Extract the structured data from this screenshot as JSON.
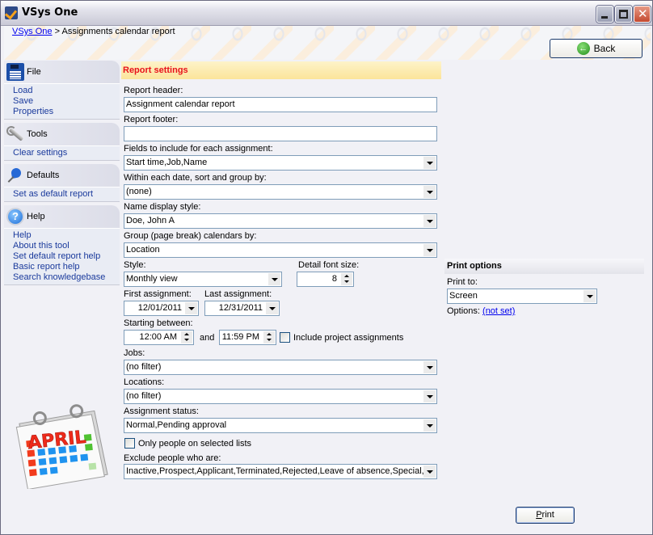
{
  "window": {
    "title": "VSys One",
    "controls": {
      "minimize": "minimize",
      "maximize": "maximize",
      "close": "close"
    }
  },
  "breadcrumb": {
    "root": "VSys One",
    "separator": ">",
    "current": "Assignments calendar report"
  },
  "back_button": {
    "label": "Back",
    "icon": "back-arrow-icon"
  },
  "sidebar": {
    "groups": [
      {
        "title": "File",
        "icon": "floppy-disk-icon",
        "items": [
          "Load",
          "Save",
          "Properties"
        ]
      },
      {
        "title": "Tools",
        "icon": "wrench-icon",
        "items": [
          "Clear settings"
        ]
      },
      {
        "title": "Defaults",
        "icon": "pushpin-icon",
        "items": [
          "Set as default report"
        ]
      },
      {
        "title": "Help",
        "icon": "help-icon",
        "items": [
          "Help",
          "About this tool",
          "Set default report help",
          "Basic report help",
          "Search knowledgebase"
        ]
      }
    ],
    "illustration": {
      "icon": "calendar-april-icon",
      "text": "APRIL"
    }
  },
  "report_settings": {
    "section_title": "Report settings",
    "report_header": {
      "label": "Report header:",
      "value": "Assignment calendar report"
    },
    "report_footer": {
      "label": "Report footer:",
      "value": ""
    },
    "fields_to_include": {
      "label": "Fields to include for each assignment:",
      "value": "Start time,Job,Name"
    },
    "sort_group_by": {
      "label": "Within each date, sort and group by:",
      "value": "(none)"
    },
    "name_display_style": {
      "label": "Name display style:",
      "value": "Doe, John A"
    },
    "group_calendars_by": {
      "label": "Group (page break) calendars by:",
      "value": "Location"
    },
    "style": {
      "label": "Style:",
      "value": "Monthly view"
    },
    "detail_font_size": {
      "label": "Detail font size:",
      "value": "8"
    },
    "first_assignment": {
      "label": "First assignment:",
      "value": "12/01/2011"
    },
    "last_assignment": {
      "label": "Last assignment:",
      "value": "12/31/2011"
    },
    "starting_between": {
      "label": "Starting between:",
      "from": "12:00 AM",
      "and_label": "and",
      "to": "11:59 PM"
    },
    "include_project_assignments": {
      "label": "Include project assignments",
      "checked": false
    },
    "jobs": {
      "label": "Jobs:",
      "value": "(no filter)"
    },
    "locations": {
      "label": "Locations:",
      "value": "(no filter)"
    },
    "assignment_status": {
      "label": "Assignment status:",
      "value": "Normal,Pending approval"
    },
    "only_selected_lists": {
      "label": "Only people on selected lists",
      "checked": false
    },
    "exclude_people": {
      "label": "Exclude people who are:",
      "value": "Inactive,Prospect,Applicant,Terminated,Rejected,Leave of absence,Special,"
    }
  },
  "print_options": {
    "section_title": "Print options",
    "print_to": {
      "label": "Print to:",
      "value": "Screen"
    },
    "options": {
      "label": "Options:",
      "value": "(not set)"
    },
    "print_button": {
      "label": "Print",
      "accesskey": "P"
    }
  },
  "colors": {
    "section_title": "#e8111b",
    "link": "#1a3a9c",
    "section_bg": "#fce49a",
    "window_bg": "#f1f1f6"
  }
}
